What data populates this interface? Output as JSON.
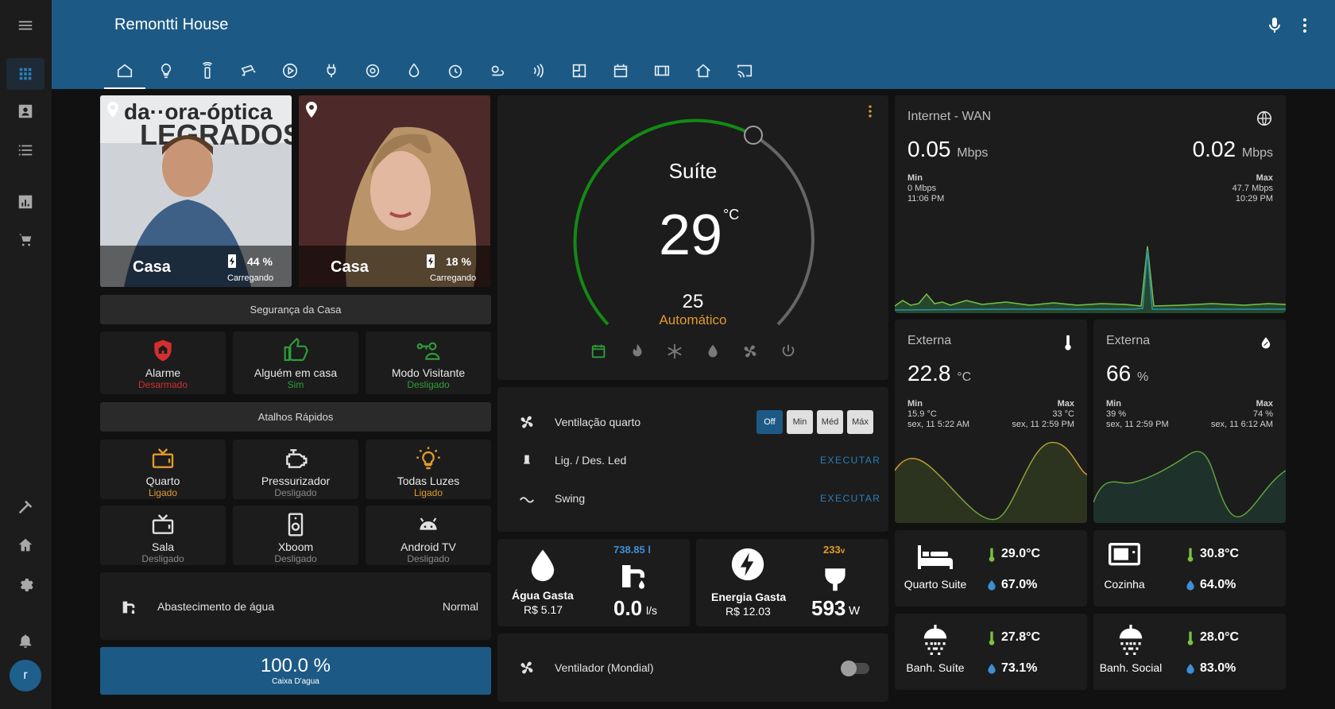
{
  "app": {
    "title": "Remontti House"
  },
  "colors": {
    "topbar": "#1c5a85",
    "accent": "#2a7fbf",
    "green": "#2e9e38",
    "orange": "#e09a2d",
    "red": "#d32f2f"
  },
  "sidebar": {
    "icons": [
      "menu-icon",
      "dashboard-icon",
      "person-card-icon",
      "list-icon",
      "chart-icon",
      "cart-icon",
      "hammer-icon",
      "home-gear-icon",
      "settings-icon",
      "bell-icon"
    ],
    "user_initial": "r"
  },
  "tabs": [
    "home-tab",
    "light-tab",
    "remote-tab",
    "camera-tab",
    "media-tab",
    "plug-tab",
    "sync-tab",
    "water-tab",
    "clock-tab",
    "weather-tab",
    "signal-tab",
    "floorplan-tab",
    "calendar-tab",
    "video-tab",
    "house-tab",
    "cast-tab"
  ],
  "persons": [
    {
      "location": "Casa",
      "battery": "44 %",
      "status": "Carregando"
    },
    {
      "location": "Casa",
      "battery": "18 %",
      "status": "Carregando"
    }
  ],
  "security": {
    "header": "Segurança da Casa",
    "buttons": [
      {
        "name": "Alarme",
        "state": "Desarmado"
      },
      {
        "name": "Alguém em casa",
        "state": "Sim"
      },
      {
        "name": "Modo Visitante",
        "state": "Desligado"
      }
    ]
  },
  "shortcuts": {
    "header": "Atalhos Rápidos",
    "buttons": [
      {
        "name": "Quarto",
        "state": "Ligado"
      },
      {
        "name": "Pressurizador",
        "state": "Desligado"
      },
      {
        "name": "Todas Luzes",
        "state": "Ligado"
      },
      {
        "name": "Sala",
        "state": "Desligado"
      },
      {
        "name": "Xboom",
        "state": "Desligado"
      },
      {
        "name": "Android TV",
        "state": "Desligado"
      }
    ]
  },
  "water_supply": {
    "label": "Abastecimento de água",
    "value": "Normal"
  },
  "tank": {
    "value": "100.0 %",
    "label": "Caixa D'agua",
    "fraction": 1.0
  },
  "thermostat": {
    "name": "Suíte",
    "current": "29",
    "unit": "°C",
    "target": "25",
    "mode": "Automático",
    "target_value": 25,
    "current_value": 29
  },
  "entities": [
    {
      "name": "Ventilação quarto",
      "options": [
        "Off",
        "Min",
        "Méd",
        "Máx"
      ],
      "selected": "Off"
    },
    {
      "name": "Lig. / Des. Led",
      "action": "EXECUTAR"
    },
    {
      "name": "Swing",
      "action": "EXECUTAR"
    }
  ],
  "water_usage": {
    "title": "Água Gasta",
    "cost": "R$ 5.17",
    "volume": "738.85 l",
    "flow": "0.0",
    "flow_unit": "l/s"
  },
  "energy": {
    "title": "Energia Gasta",
    "cost": "R$ 12.03",
    "voltage": "233",
    "voltage_unit": "v",
    "power": "593",
    "power_unit": "W"
  },
  "fan": {
    "name": "Ventilador (Mondial)",
    "on": false
  },
  "internet": {
    "title": "Internet - WAN",
    "down": "0.05",
    "up": "0.02",
    "unit": "Mbps",
    "min_label": "Min",
    "min_value": "0 Mbps",
    "min_time": "11:06 PM",
    "max_label": "Max",
    "max_value": "47.7 Mbps",
    "max_time": "10:29 PM"
  },
  "ext_temp": {
    "title": "Externa",
    "value": "22.8",
    "unit": "°C",
    "min_label": "Min",
    "min_value": "15.9 °C",
    "min_time": "sex, 11 5:22 AM",
    "max_label": "Max",
    "max_value": "33 °C",
    "max_time": "sex, 11 2:59 PM"
  },
  "ext_hum": {
    "title": "Externa",
    "value": "66",
    "unit": "%",
    "min_label": "Min",
    "min_value": "39 %",
    "min_time": "sex, 11 2:59 PM",
    "max_label": "Max",
    "max_value": "74 %",
    "max_time": "sex, 11 6:12 AM"
  },
  "rooms": [
    {
      "name": "Quarto Suite",
      "temp": "29.0°C",
      "hum": "67.0%"
    },
    {
      "name": "Cozinha",
      "temp": "30.8°C",
      "hum": "64.0%"
    },
    {
      "name": "Banh. Suíte",
      "temp": "27.8°C",
      "hum": "73.1%"
    },
    {
      "name": "Banh. Social",
      "temp": "28.0°C",
      "hum": "83.0%"
    }
  ]
}
